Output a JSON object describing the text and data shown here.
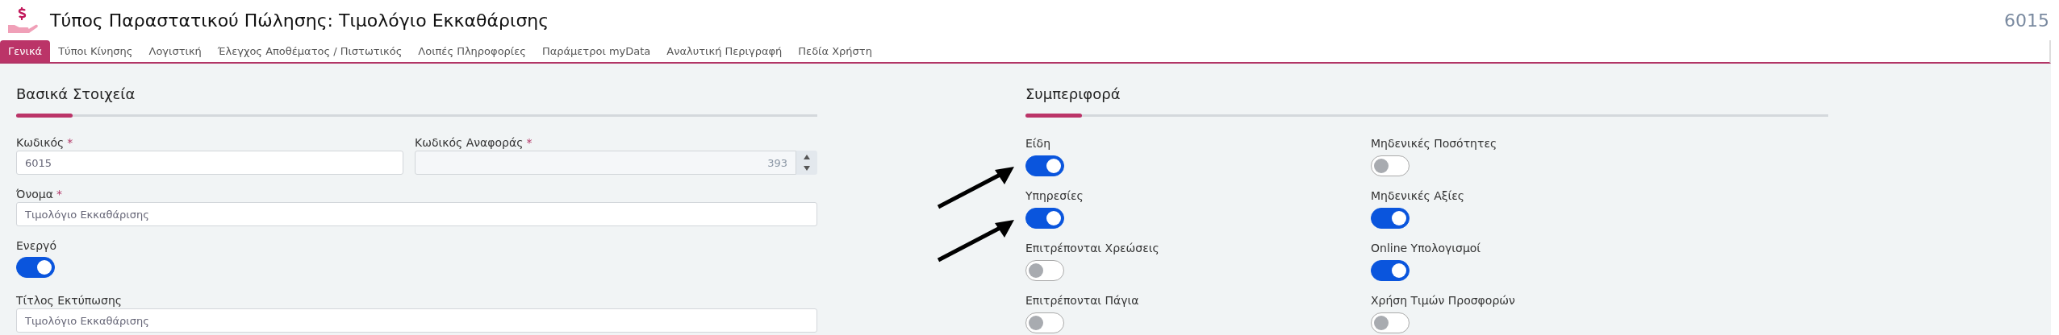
{
  "header": {
    "title": "Τύπος Παραστατικού Πώλησης: Τιμολόγιο Εκκαθάρισης",
    "code": "6015"
  },
  "tabs": [
    {
      "label": "Γενικά",
      "selected": true
    },
    {
      "label": "Τύποι Κίνησης",
      "selected": false
    },
    {
      "label": "Λογιστική",
      "selected": false
    },
    {
      "label": "Έλεγχος Αποθέματος / Πιστωτικός",
      "selected": false
    },
    {
      "label": "Λοιπές Πληροφορίες",
      "selected": false
    },
    {
      "label": "Παράμετροι myData",
      "selected": false
    },
    {
      "label": "Αναλυτική Περιγραφή",
      "selected": false
    },
    {
      "label": "Πεδία Χρήστη",
      "selected": false
    }
  ],
  "basic": {
    "title": "Βασικά Στοιχεία",
    "rows": [
      [
        {
          "kind": "text",
          "label": "Κωδικός",
          "required_mark": "*",
          "value": "6015",
          "disabled": false
        },
        {
          "kind": "number",
          "label": "Κωδικός Αναφοράς",
          "required_mark": "*",
          "value": "393",
          "disabled": true
        }
      ],
      [
        {
          "kind": "text",
          "label": "Όνομα",
          "required_mark": "*",
          "value": "Τιμολόγιο Εκκαθάρισης",
          "disabled": false
        }
      ],
      [
        {
          "kind": "toggle",
          "label": "Ενεργό",
          "on": true
        }
      ],
      [
        {
          "kind": "text",
          "label": "Τίτλος Εκτύπωσης",
          "value": "Τιμολόγιο Εκκαθάρισης",
          "disabled": false
        }
      ]
    ]
  },
  "behaviour": {
    "title": "Συμπεριφορά",
    "toggles": [
      {
        "label": "Είδη",
        "on": true
      },
      {
        "label": "Μηδενικές Ποσότητες",
        "on": false
      },
      {
        "label": "Υπηρεσίες",
        "on": true
      },
      {
        "label": "Μηδενικές Αξίες",
        "on": true
      },
      {
        "label": "Επιτρέπονται Χρεώσεις",
        "on": false
      },
      {
        "label": "Online Υπολογισμοί",
        "on": true
      },
      {
        "label": "Επιτρέπονται Πάγια",
        "on": false
      },
      {
        "label": "Χρήση Τιμών Προσφορών",
        "on": false
      }
    ]
  }
}
